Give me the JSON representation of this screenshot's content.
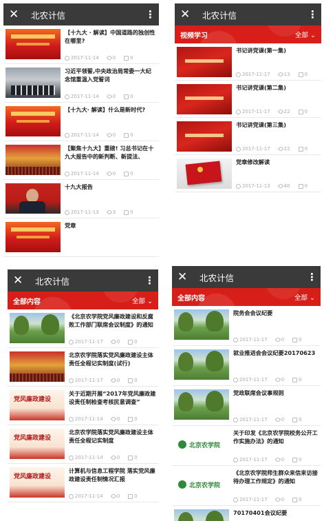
{
  "panels": [
    {
      "app_title": "北农计信",
      "section": null,
      "items": [
        {
          "title": "【十九大 · 解读】中国道路的独创性在哪里?",
          "date": "2017-11-14",
          "views": "0",
          "comments": "0",
          "thumb": "banner"
        },
        {
          "title": "习近平领誓,中央政治局常委一大纪念馆重温入党誓词",
          "date": "2017-11-14",
          "views": "0",
          "comments": "0",
          "thumb": "meeting"
        },
        {
          "title": "【十九大· 解读】什么是新时代?",
          "date": "2017-11-14",
          "views": "0",
          "comments": "0",
          "thumb": "banner"
        },
        {
          "title": "【聚焦十九大】重磅! 习总书记在十九大报告中的新判断、新提法、",
          "date": "2017-11-14",
          "views": "0",
          "comments": "0",
          "thumb": "hall"
        },
        {
          "title": "十九大报告",
          "date": "2017-11-13",
          "views": "3",
          "comments": "0",
          "thumb": "portrait"
        },
        {
          "title": "党章",
          "date": "",
          "views": "",
          "comments": "",
          "thumb": "banner"
        }
      ]
    },
    {
      "app_title": "北农计信",
      "section": {
        "title": "视频学习",
        "filter": "全部"
      },
      "items": [
        {
          "title": "书记讲党课(第一集)",
          "date": "2017-11-17",
          "views": "13",
          "comments": "0",
          "thumb": "partyclass"
        },
        {
          "title": "书记讲党课(第二集)",
          "date": "2017-11-17",
          "views": "22",
          "comments": "0",
          "thumb": "partyclass"
        },
        {
          "title": "书记讲党课(第三集)",
          "date": "2017-11-17",
          "views": "22",
          "comments": "0",
          "thumb": "partyclass"
        },
        {
          "title": "党章修改解读",
          "date": "2017-11-13",
          "views": "40",
          "comments": "0",
          "thumb": "book"
        }
      ]
    },
    {
      "app_title": "北农计信",
      "section": {
        "title": "全部内容",
        "filter": "全部"
      },
      "items": [
        {
          "title": "《北京农学院党风廉政建设和反腐败工作部门联席会议制度》的通知",
          "date": "2017-11-17",
          "views": "0",
          "comments": "0",
          "thumb": "campus"
        },
        {
          "title": "北京农学院落实党风廉政建设主体责任全程记实制度(试行)",
          "date": "2017-11-17",
          "views": "0",
          "comments": "0",
          "thumb": "hall"
        },
        {
          "title": "关于近期开展“2017年党风廉政建设责任制检查考核民意调查”",
          "date": "2017-11-14",
          "views": "0",
          "comments": "0",
          "thumb": "lianzheng"
        },
        {
          "title": "北京农学院落实党风廉政建设主体责任全程记实制度",
          "date": "2017-11-14",
          "views": "0",
          "comments": "0",
          "thumb": "lianzheng"
        },
        {
          "title": "计算机与信息工程学院 落实党风廉政建设责任制情况汇报",
          "date": "2017-11-14",
          "views": "0",
          "comments": "0",
          "thumb": "lianzheng"
        }
      ]
    },
    {
      "app_title": "北农计信",
      "section": {
        "title": "全部内容",
        "filter": "全部"
      },
      "items": [
        {
          "title": "院务会会议纪要",
          "date": "2017-11-17",
          "views": "0",
          "comments": "0",
          "thumb": "campus"
        },
        {
          "title": "就业推进会会议纪要20170623",
          "date": "2017-11-17",
          "views": "0",
          "comments": "0",
          "thumb": "campus"
        },
        {
          "title": "党政联席会议事规则",
          "date": "2017-11-17",
          "views": "0",
          "comments": "0",
          "thumb": "campus"
        },
        {
          "title": "关于印发《北京农学院校务公开工作实施办法》的通知",
          "date": "2017-11-17",
          "views": "0",
          "comments": "0",
          "thumb": "logo"
        },
        {
          "title": "《北京农学院师生群众来信来访接待办理工作规定》的通知",
          "date": "2017-11-17",
          "views": "0",
          "comments": "0",
          "thumb": "logo"
        },
        {
          "title": "70170401会议纪要",
          "date": "",
          "views": "",
          "comments": "",
          "thumb": "campus"
        }
      ]
    }
  ],
  "thumb_text": {
    "lianzheng": "党风廉政建设",
    "logo": "北京农学院"
  },
  "colors": {
    "appbar": "#3a3a3a",
    "section_red": "#d81e18",
    "meta_gray": "#aaaaaa"
  },
  "icons": {
    "close": "close-icon",
    "more": "more-vertical-icon",
    "views": "eye-icon",
    "comments": "comment-icon",
    "date": "clock-icon"
  }
}
